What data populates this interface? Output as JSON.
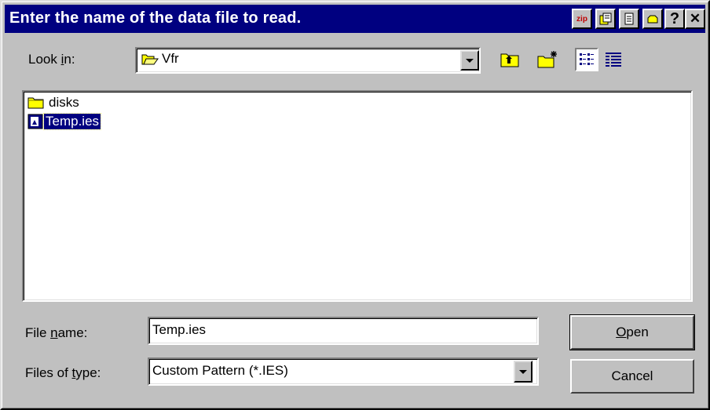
{
  "window": {
    "title": "Enter the name of the data file to read."
  },
  "title_buttons": {
    "zip_label": "zip",
    "help_label": "?",
    "close_label": "✕"
  },
  "look_in": {
    "label_pre": "Look ",
    "label_u": "i",
    "label_post": "n:",
    "value": "Vfr"
  },
  "files": [
    {
      "name": "disks",
      "type": "folder"
    },
    {
      "name": "Temp.ies",
      "type": "file",
      "selected": true
    }
  ],
  "file_name": {
    "label_pre": "File ",
    "label_u": "n",
    "label_post": "ame:",
    "value": "Temp.ies"
  },
  "file_type": {
    "label_pre": "Files of ",
    "label_u": "t",
    "label_post": "ype:",
    "value": "Custom Pattern (*.IES)"
  },
  "buttons": {
    "open_u": "O",
    "open_rest": "pen",
    "cancel": "Cancel"
  },
  "colors": {
    "titlebar": "#000080",
    "face": "#c0c0c0",
    "selection": "#000080",
    "folder": "#ffff00"
  }
}
